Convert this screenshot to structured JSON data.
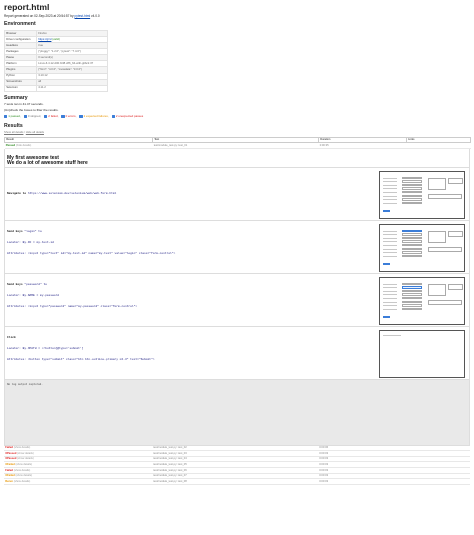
{
  "title": "report.html",
  "generated": {
    "prefix": "Report generated on 02-Sep-2023 at 20:54:57 by ",
    "link": "pytest-html",
    "suffix": " v4.0.0"
  },
  "environment": {
    "heading": "Environment",
    "rows": [
      {
        "key": "Browser",
        "value": "Firefox"
      },
      {
        "key": "Driver configuration",
        "value": "https://gr/d",
        "extra": "(valid)"
      },
      {
        "key": "Headless",
        "value": "true"
      },
      {
        "key": "Packages",
        "value": "{\"pluggy\": \"1.2.0\", \"pytest\": \"7.4.0\"}"
      },
      {
        "key": "Pause",
        "value": "0 second(s)"
      },
      {
        "key": "Platform",
        "value": "Linux-6.4.12-200.fc38.x86_64-with-glibc2.37"
      },
      {
        "key": "Plugins",
        "value": "{\"html\": \"4.0.0\", \"metadata\": \"3.0.0\"}"
      },
      {
        "key": "Python",
        "value": "3.10.12"
      },
      {
        "key": "Screenshots",
        "value": "all"
      },
      {
        "key": "Selenium",
        "value": "4.11.2"
      }
    ]
  },
  "summary": {
    "heading": "Summary",
    "tests_ran": "7 tests ran in 41.47 seconds.",
    "uncheck_hint": "(Un)check the boxes to filter the results.",
    "filters": [
      {
        "label": "1 passed,",
        "cls": "f-passed"
      },
      {
        "label": "0 skipped,",
        "cls": "f-skipped"
      },
      {
        "label": "2 failed,",
        "cls": "f-failed"
      },
      {
        "label": "0 errors,",
        "cls": "f-errors"
      },
      {
        "label": "2 expected failures,",
        "cls": "f-xfail"
      },
      {
        "label": "2 unexpected passes",
        "cls": "f-xpass"
      }
    ]
  },
  "results": {
    "heading": "Results",
    "show_all": "Show all details",
    "hide_all": "Hide all details",
    "columns": [
      "Result",
      "Test",
      "Duration",
      "Links"
    ],
    "first_row": {
      "result": "Passed",
      "details": "(hide details)",
      "test": "test/module_test.py::test_01",
      "duration": "0:00:35",
      "links": ""
    },
    "intro_lines": [
      "My first awesome test",
      "We do a lot of awesome stuff here"
    ],
    "steps": [
      {
        "lines": [
          {
            "label": "Navigate to",
            "text": " https://www.selenium.dev/selenium/web/web-form.html"
          }
        ]
      },
      {
        "lines": [
          {
            "label": "Send keys",
            "text": " \"login\" to"
          },
          {
            "label": "",
            "text": "Locator: By.ID = my-text-id"
          },
          {
            "label": "",
            "text": "Attributes: <input type=\"text\" id=\"my-text-id\" name=\"my-text\" value=\"login\" class=\"form-control\">"
          }
        ]
      },
      {
        "lines": [
          {
            "label": "Send keys",
            "text": " \"password\" to"
          },
          {
            "label": "",
            "text": "Locator: By.NAME = my-password"
          },
          {
            "label": "",
            "text": "Attributes: <input type=\"password\" name=\"my-password\" class=\"form-control\">"
          }
        ]
      },
      {
        "lines": [
          {
            "label": "Click",
            "text": ""
          },
          {
            "label": "",
            "text": "Locator: By.XPATH = //button[@type='submit']"
          },
          {
            "label": "",
            "text": "Attributes: <button type=\"submit\" class=\"btn btn-outline-primary mt-3\" text=\"Submit\">"
          }
        ]
      }
    ],
    "log": "No log output captured.",
    "other_rows": [
      {
        "result": "Failed",
        "cls": "st-failed",
        "details": "(show details)",
        "test": "test/module_test.py::test_02",
        "duration": "0:00:06"
      },
      {
        "result": "XPassed",
        "cls": "st-xpassed",
        "details": "(show details)",
        "test": "test/module_test.py::test_03",
        "duration": "0:00:03"
      },
      {
        "result": "XPassed",
        "cls": "st-xpassed",
        "details": "(show details)",
        "test": "test/module_test.py::test_04",
        "duration": "0:00:03"
      },
      {
        "result": "XFailed",
        "cls": "st-xfailed",
        "details": "(show details)",
        "test": "test/module_test.py::test_05",
        "duration": "0:00:03"
      },
      {
        "result": "Failed",
        "cls": "st-failed",
        "details": "(show details)",
        "test": "test/module_test.py::test_06",
        "duration": "0:00:03"
      },
      {
        "result": "XFailed",
        "cls": "st-xfailed",
        "details": "(show details)",
        "test": "test/module_test.py::test_07",
        "duration": "0:00:03"
      },
      {
        "result": "Rerun",
        "cls": "st-rerun",
        "details": "(show details)",
        "test": "test/module_test.py::test_08",
        "duration": "0:00:03"
      }
    ]
  }
}
